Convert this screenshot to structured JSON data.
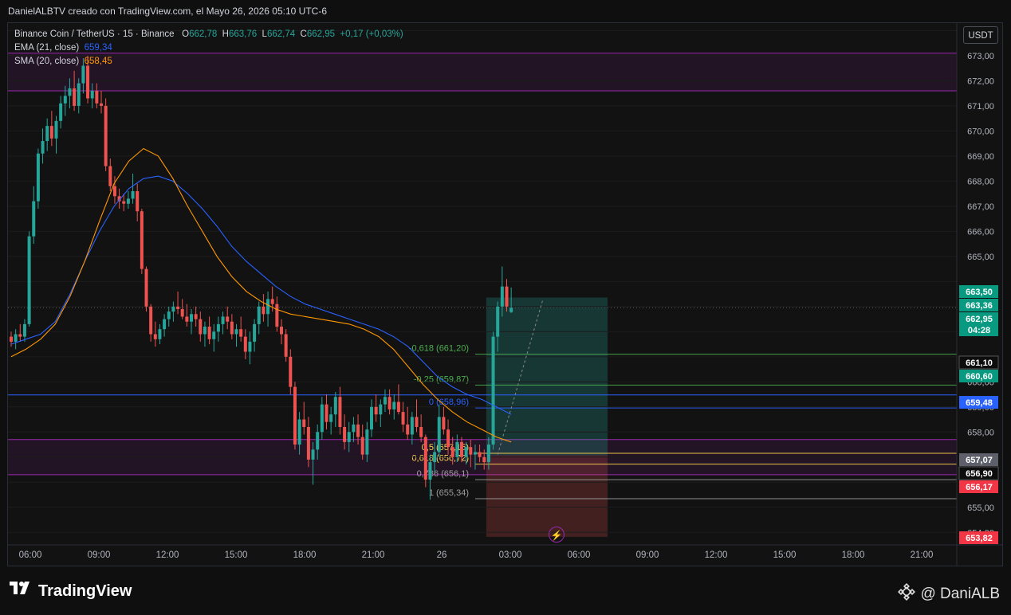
{
  "header": {
    "caption": "DanielALBTV creado con TradingView.com, el Mayo 26, 2026 05:10 UTC-6"
  },
  "legend": {
    "symbol": "Binance Coin / TetherUS · 15 · Binance",
    "o_label": "O",
    "o_value": "662,78",
    "h_label": "H",
    "h_value": "663,76",
    "l_label": "L",
    "l_value": "662,74",
    "c_label": "C",
    "c_value": "662,95",
    "change": "+0,17 (+0,03%)",
    "ema_label": "EMA (21, close)",
    "ema_value": "659,34",
    "sma_label": "SMA (20, close)",
    "sma_value": "658,45"
  },
  "currency_button": "USDT",
  "footer": {
    "brand": "TradingView",
    "author": "@ DaniALB"
  },
  "colors": {
    "up": "#26a69a",
    "down": "#ef5350",
    "ema": "#2962ff",
    "sma": "#ff9800",
    "zone_purple": "#9c27b0",
    "fib_green": "#4caf50",
    "fib_yellow": "#ffd54f"
  },
  "icons": [
    "tradingview-logo-icon",
    "binance-diamond-icon",
    "lightning-icon"
  ],
  "chart_data": {
    "type": "candlestick",
    "symbol": "BNB/USDT",
    "interval": "15",
    "ylim": [
      653.5,
      674.3
    ],
    "y_ticks": [
      "674,00",
      "673,00",
      "672,00",
      "671,00",
      "670,00",
      "669,00",
      "668,00",
      "667,00",
      "666,00",
      "665,00",
      "662,00",
      "660,00",
      "659,00",
      "658,00",
      "655,00",
      "654,00"
    ],
    "x_ticks": [
      "06:00",
      "09:00",
      "12:00",
      "15:00",
      "18:00",
      "21:00",
      "26",
      "03:00",
      "06:00",
      "09:00",
      "12:00",
      "15:00",
      "18:00",
      "21:00"
    ],
    "price_labels": [
      {
        "text": "663,50",
        "kind": "green"
      },
      {
        "text": "663,36",
        "kind": "green"
      },
      {
        "text": "662,95",
        "kind": "green"
      },
      {
        "text": "04:28",
        "kind": "green"
      },
      {
        "text": "661,10",
        "kind": "dark"
      },
      {
        "text": "660,60",
        "kind": "green"
      },
      {
        "text": "659,48",
        "kind": "blue"
      },
      {
        "text": "657,07",
        "kind": "gray"
      },
      {
        "text": "656,90",
        "kind": "dark"
      },
      {
        "text": "656,17",
        "kind": "red"
      },
      {
        "text": "653,82",
        "kind": "red"
      }
    ],
    "zones": [
      {
        "top": 673.1,
        "bottom": 671.6
      },
      {
        "top": 657.7,
        "bottom": 656.3
      }
    ],
    "horizontal_levels": [
      {
        "price": 659.48
      },
      {
        "price": 662.95
      }
    ],
    "fib_levels": [
      {
        "label": "-0,618 (661,20)",
        "price": 661.1
      },
      {
        "label": "-0,25 (659,87)",
        "price": 659.87
      },
      {
        "label": "0 (658,96)",
        "price": 658.96
      },
      {
        "label": "0,5 (657,15)",
        "price": 657.15
      },
      {
        "label": "0,618 (656,72)",
        "price": 656.72
      },
      {
        "label": "0,786 (656,1)",
        "price": 656.1
      },
      {
        "label": "1 (655,34)",
        "price": 655.34
      }
    ],
    "position": {
      "entry": 657.07,
      "target": 663.36,
      "stop": 653.82
    },
    "candles": [
      [
        661.8,
        662.0,
        661.4,
        661.6
      ],
      [
        661.6,
        662.1,
        661.3,
        661.9
      ],
      [
        661.9,
        662.3,
        661.6,
        661.8
      ],
      [
        661.8,
        662.5,
        661.6,
        662.3
      ],
      [
        662.3,
        666.0,
        662.2,
        665.8
      ],
      [
        665.8,
        667.8,
        665.5,
        667.2
      ],
      [
        667.2,
        669.3,
        666.9,
        669.1
      ],
      [
        669.1,
        670.1,
        668.7,
        669.6
      ],
      [
        669.6,
        670.5,
        669.2,
        670.2
      ],
      [
        670.2,
        670.8,
        669.4,
        669.7
      ],
      [
        669.7,
        670.6,
        669.1,
        670.4
      ],
      [
        670.4,
        671.4,
        670.1,
        671.1
      ],
      [
        671.1,
        671.8,
        670.6,
        671.4
      ],
      [
        671.4,
        672.1,
        670.9,
        671.7
      ],
      [
        671.7,
        672.4,
        670.8,
        671.0
      ],
      [
        671.0,
        672.1,
        670.7,
        671.9
      ],
      [
        671.9,
        672.9,
        671.5,
        672.6
      ],
      [
        672.6,
        673.0,
        671.1,
        671.3
      ],
      [
        671.3,
        671.9,
        670.9,
        671.6
      ],
      [
        671.6,
        671.9,
        670.9,
        671.1
      ],
      [
        671.1,
        671.6,
        670.7,
        671.0
      ],
      [
        671.0,
        671.3,
        668.4,
        668.6
      ],
      [
        668.6,
        668.9,
        667.6,
        667.8
      ],
      [
        667.8,
        668.2,
        667.1,
        667.4
      ],
      [
        667.4,
        667.7,
        666.9,
        667.2
      ],
      [
        667.2,
        667.5,
        666.8,
        667.1
      ],
      [
        667.1,
        667.6,
        666.9,
        667.3
      ],
      [
        667.3,
        668.3,
        667.1,
        667.6
      ],
      [
        667.6,
        667.9,
        666.4,
        666.8
      ],
      [
        666.8,
        666.9,
        664.3,
        664.5
      ],
      [
        664.5,
        664.6,
        662.8,
        663.0
      ],
      [
        663.0,
        663.1,
        661.6,
        661.9
      ],
      [
        661.9,
        662.4,
        661.4,
        661.7
      ],
      [
        661.7,
        662.3,
        661.5,
        662.1
      ],
      [
        662.1,
        662.7,
        661.8,
        662.5
      ],
      [
        662.5,
        663.0,
        662.2,
        662.8
      ],
      [
        662.8,
        663.2,
        662.4,
        663.0
      ],
      [
        663.0,
        663.6,
        662.7,
        662.9
      ],
      [
        662.9,
        663.3,
        662.5,
        662.6
      ],
      [
        662.6,
        663.1,
        662.2,
        662.4
      ],
      [
        662.4,
        662.9,
        661.9,
        662.7
      ],
      [
        662.7,
        663.0,
        662.2,
        662.5
      ],
      [
        662.5,
        662.8,
        661.6,
        661.9
      ],
      [
        661.9,
        662.4,
        661.4,
        662.2
      ],
      [
        662.2,
        662.6,
        661.5,
        661.7
      ],
      [
        661.7,
        662.3,
        661.2,
        662.0
      ],
      [
        662.0,
        662.6,
        661.6,
        662.3
      ],
      [
        662.3,
        662.8,
        661.9,
        662.6
      ],
      [
        662.6,
        663.0,
        662.1,
        662.4
      ],
      [
        662.4,
        662.7,
        661.7,
        661.9
      ],
      [
        661.9,
        662.3,
        661.4,
        662.1
      ],
      [
        662.1,
        662.6,
        661.6,
        661.8
      ],
      [
        661.8,
        662.1,
        660.9,
        661.2
      ],
      [
        661.2,
        662.0,
        660.7,
        661.6
      ],
      [
        661.6,
        662.5,
        661.2,
        662.3
      ],
      [
        662.3,
        663.2,
        661.9,
        663.0
      ],
      [
        663.0,
        663.5,
        662.4,
        662.7
      ],
      [
        662.7,
        663.6,
        662.2,
        663.3
      ],
      [
        663.3,
        663.8,
        662.8,
        663.1
      ],
      [
        663.1,
        663.4,
        662.0,
        662.2
      ],
      [
        662.2,
        662.5,
        661.5,
        661.9
      ],
      [
        661.9,
        662.1,
        660.8,
        661.0
      ],
      [
        661.0,
        661.3,
        659.5,
        659.8
      ],
      [
        659.8,
        660.0,
        657.3,
        657.5
      ],
      [
        657.5,
        658.8,
        657.1,
        658.5
      ],
      [
        658.5,
        659.2,
        657.9,
        658.2
      ],
      [
        658.2,
        658.6,
        656.6,
        656.9
      ],
      [
        656.9,
        657.6,
        655.9,
        657.3
      ],
      [
        657.3,
        658.3,
        656.9,
        658.0
      ],
      [
        658.0,
        659.4,
        657.7,
        659.1
      ],
      [
        659.1,
        659.5,
        658.1,
        658.4
      ],
      [
        658.4,
        659.0,
        657.9,
        658.7
      ],
      [
        658.7,
        659.6,
        658.2,
        659.4
      ],
      [
        659.4,
        659.8,
        657.9,
        658.2
      ],
      [
        658.2,
        658.7,
        657.3,
        657.6
      ],
      [
        657.6,
        658.4,
        657.2,
        658.0
      ],
      [
        658.0,
        658.6,
        657.6,
        658.3
      ],
      [
        658.3,
        658.7,
        657.5,
        657.8
      ],
      [
        657.8,
        658.3,
        656.9,
        657.1
      ],
      [
        657.1,
        658.4,
        656.8,
        658.1
      ],
      [
        658.1,
        659.3,
        657.8,
        659.0
      ],
      [
        659.0,
        659.5,
        658.4,
        658.7
      ],
      [
        658.7,
        659.3,
        658.2,
        659.1
      ],
      [
        659.1,
        659.7,
        658.8,
        659.4
      ],
      [
        659.4,
        659.7,
        658.7,
        658.9
      ],
      [
        658.9,
        659.5,
        658.5,
        659.2
      ],
      [
        659.2,
        659.9,
        658.7,
        658.8
      ],
      [
        658.8,
        659.2,
        658.0,
        658.3
      ],
      [
        658.3,
        659.0,
        657.7,
        657.9
      ],
      [
        657.9,
        658.8,
        657.5,
        658.6
      ],
      [
        658.6,
        659.3,
        658.0,
        658.2
      ],
      [
        658.2,
        658.7,
        657.6,
        657.8
      ],
      [
        657.8,
        657.9,
        655.8,
        656.1
      ],
      [
        656.1,
        657.1,
        655.3,
        656.8
      ],
      [
        656.8,
        657.6,
        656.4,
        657.2
      ],
      [
        657.2,
        659.1,
        657.0,
        658.6
      ],
      [
        658.6,
        659.0,
        657.9,
        658.1
      ],
      [
        658.1,
        658.5,
        657.1,
        657.4
      ],
      [
        657.4,
        657.8,
        656.7,
        657.0
      ],
      [
        657.0,
        657.9,
        656.8,
        657.6
      ],
      [
        657.6,
        657.8,
        656.8,
        657.0
      ],
      [
        657.0,
        657.6,
        656.7,
        657.4
      ],
      [
        657.4,
        657.7,
        656.6,
        657.1
      ],
      [
        657.1,
        657.5,
        656.5,
        657.2
      ],
      [
        657.2,
        657.5,
        656.8,
        657.0
      ],
      [
        657.0,
        657.3,
        656.5,
        656.8
      ],
      [
        656.8,
        657.8,
        656.5,
        657.5
      ],
      [
        657.5,
        662.0,
        657.3,
        661.8
      ],
      [
        661.8,
        663.2,
        661.2,
        663.0
      ],
      [
        663.0,
        664.6,
        662.6,
        663.8
      ],
      [
        663.8,
        664.1,
        662.8,
        663.0
      ],
      [
        662.78,
        663.76,
        662.74,
        662.95
      ]
    ],
    "ema_21": [
      661.5,
      661.7,
      661.9,
      662.4,
      663.5,
      664.8,
      666.0,
      667.0,
      667.7,
      668.1,
      668.2,
      668.0,
      667.5,
      666.9,
      666.2,
      665.4,
      664.8,
      664.3,
      663.8,
      663.4,
      663.1,
      662.9,
      662.7,
      662.5,
      662.3,
      662.1,
      661.8,
      661.4,
      660.8,
      660.2,
      659.8,
      659.5,
      659.3,
      659.0,
      658.7
    ],
    "sma_20": [
      661.0,
      661.3,
      661.7,
      662.3,
      663.4,
      664.8,
      666.4,
      667.9,
      668.8,
      669.3,
      669.0,
      668.1,
      667.0,
      666.0,
      665.0,
      664.2,
      663.6,
      663.2,
      662.9,
      662.7,
      662.6,
      662.5,
      662.4,
      662.3,
      662.1,
      661.8,
      661.3,
      660.6,
      659.9,
      659.3,
      658.8,
      658.4,
      658.1,
      657.8,
      657.6
    ]
  }
}
